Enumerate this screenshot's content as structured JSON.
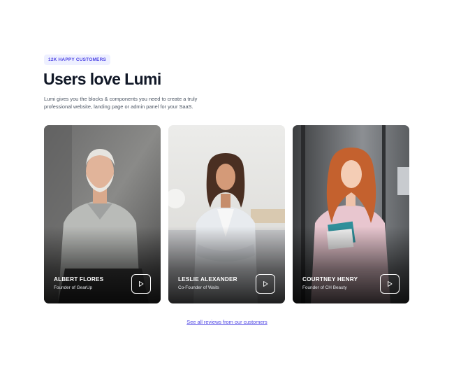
{
  "badge": "12K HAPPY CUSTOMERS",
  "title": "Users love Lumi",
  "subtitle": "Lumi gives you the blocks & components you need to create a truly professional website, landing page or admin panel for your SaaS.",
  "cards": [
    {
      "name": "ALBERT FLORES",
      "role": "Founder of GearUp",
      "play_icon": "play-icon"
    },
    {
      "name": "LESLIE ALEXANDER",
      "role": "Co-Founder of Waits",
      "play_icon": "play-icon"
    },
    {
      "name": "COURTNEY HENRY",
      "role": "Founder of CH Beauty",
      "play_icon": "play-icon"
    }
  ],
  "link": "See all reviews from our customers",
  "colors": {
    "accent": "#4f46e5",
    "badge_bg": "#eef0ff",
    "title": "#111827",
    "body_text": "#4b5563"
  }
}
